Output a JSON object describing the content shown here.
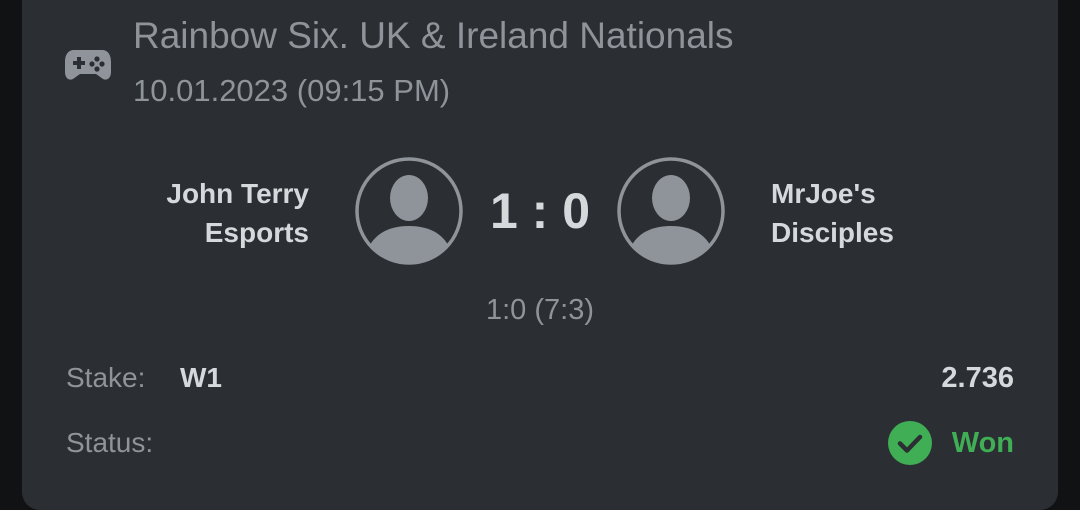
{
  "event": {
    "title": "Rainbow Six. UK & Ireland Nationals",
    "datetime": "10.01.2023 (09:15 PM)",
    "icon": "gamepad-icon"
  },
  "match": {
    "team1": {
      "name": "John Terry Esports",
      "avatar_icon": "user-avatar-icon"
    },
    "team2": {
      "name": "MrJoe's Disciples",
      "avatar_icon": "user-avatar-icon"
    },
    "score": "1 : 0",
    "detail_score": "1:0 (7:3)"
  },
  "bet": {
    "stake_label": "Stake:",
    "stake_value": "W1",
    "odds": "2.736",
    "status_label": "Status:",
    "status_value": "Won",
    "status_icon": "check-circle-icon"
  },
  "colors": {
    "background": "#111214",
    "card": "#2b2e32",
    "muted_text": "#8f949a",
    "primary_text": "#d6d9dc",
    "success": "#3fae55"
  }
}
